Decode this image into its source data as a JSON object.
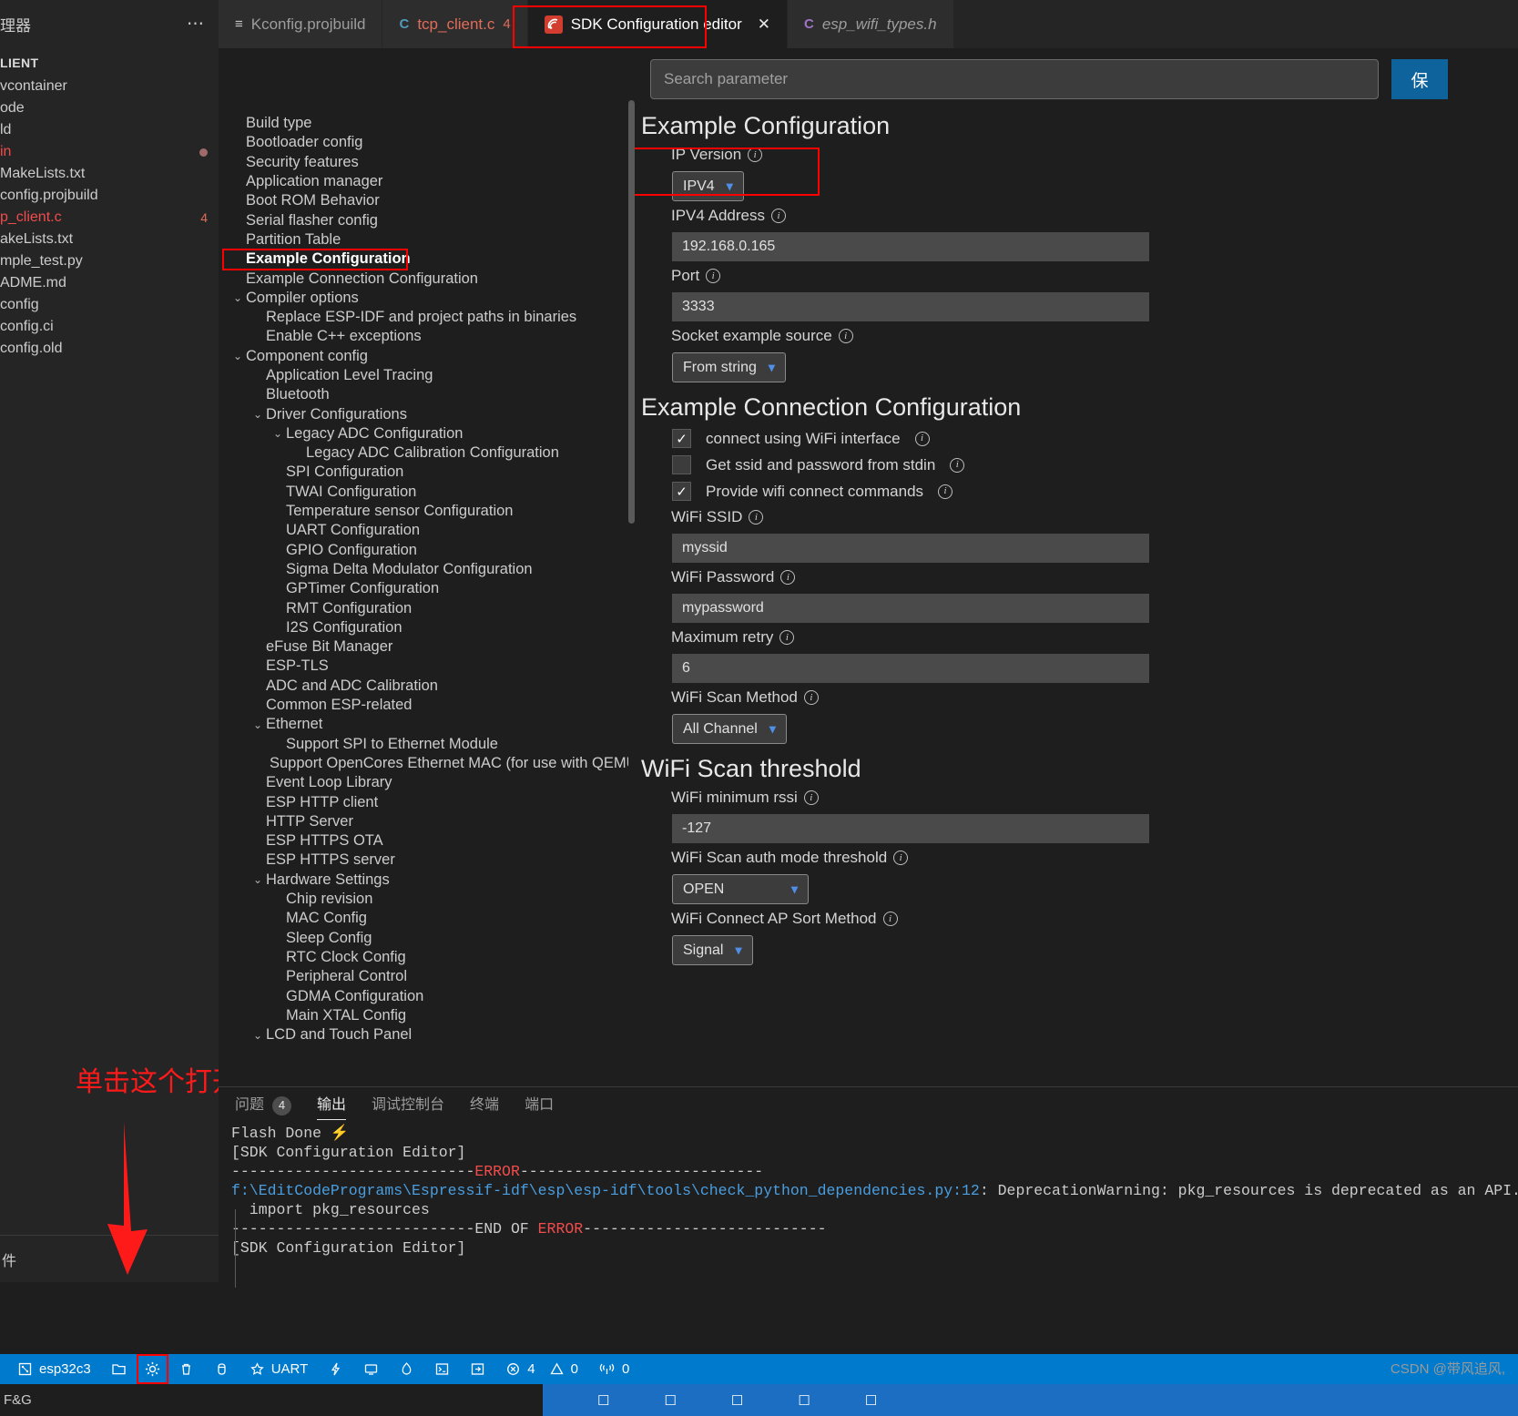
{
  "explorer": {
    "title": "理器",
    "overflow_icon": "ellipsis-icon",
    "section_label": "LIENT",
    "items": [
      {
        "label": "vcontainer",
        "state": "normal"
      },
      {
        "label": "ode",
        "state": "normal"
      },
      {
        "label": "ld",
        "state": "normal"
      },
      {
        "label": "in",
        "state": "error",
        "dot": true
      },
      {
        "label": "MakeLists.txt",
        "state": "normal"
      },
      {
        "label": "config.projbuild",
        "state": "normal"
      },
      {
        "label": "p_client.c",
        "state": "error",
        "count": "4"
      },
      {
        "label": "akeLists.txt",
        "state": "normal"
      },
      {
        "label": "mple_test.py",
        "state": "normal"
      },
      {
        "label": "ADME.md",
        "state": "normal"
      },
      {
        "label": "config",
        "state": "normal"
      },
      {
        "label": "config.ci",
        "state": "normal"
      },
      {
        "label": "config.old",
        "state": "normal"
      }
    ],
    "footer_label": "件"
  },
  "tabs": [
    {
      "label": "Kconfig.projbuild",
      "icon": "kconfig-file-icon",
      "active": false,
      "badge": "",
      "italic": false
    },
    {
      "label": "tcp_client.c",
      "icon": "c-file-icon",
      "active": false,
      "badge": "4",
      "italic": false
    },
    {
      "label": "SDK Configuration editor",
      "icon": "esp-idf-icon",
      "active": true,
      "badge": "",
      "italic": false,
      "closable": true
    },
    {
      "label": "esp_wifi_types.h",
      "icon": "c-header-file-icon",
      "active": false,
      "badge": "",
      "italic": true
    }
  ],
  "tab_close_label": "✕",
  "annotation": {
    "text": "单击这个打开menuconfig",
    "color": "#ff1a1a"
  },
  "search": {
    "placeholder": "Search parameter",
    "value": ""
  },
  "save_button_label": "保",
  "config_tree": [
    {
      "label": "Build type",
      "indent": 0,
      "chevron": ""
    },
    {
      "label": "Bootloader config",
      "indent": 0,
      "chevron": ""
    },
    {
      "label": "Security features",
      "indent": 0,
      "chevron": ""
    },
    {
      "label": "Application manager",
      "indent": 0,
      "chevron": ""
    },
    {
      "label": "Boot ROM Behavior",
      "indent": 0,
      "chevron": ""
    },
    {
      "label": "Serial flasher config",
      "indent": 0,
      "chevron": ""
    },
    {
      "label": "Partition Table",
      "indent": 0,
      "chevron": ""
    },
    {
      "label": "Example Configuration",
      "indent": 0,
      "chevron": "",
      "selected": true
    },
    {
      "label": "Example Connection Configuration",
      "indent": 0,
      "chevron": ""
    },
    {
      "label": "Compiler options",
      "indent": 0,
      "chevron": "⌄"
    },
    {
      "label": "Replace ESP-IDF and project paths in binaries",
      "indent": 1,
      "chevron": ""
    },
    {
      "label": "Enable C++ exceptions",
      "indent": 1,
      "chevron": ""
    },
    {
      "label": "Component config",
      "indent": 0,
      "chevron": "⌄"
    },
    {
      "label": "Application Level Tracing",
      "indent": 1,
      "chevron": ""
    },
    {
      "label": "Bluetooth",
      "indent": 1,
      "chevron": ""
    },
    {
      "label": "Driver Configurations",
      "indent": 1,
      "chevron": "⌄"
    },
    {
      "label": "Legacy ADC Configuration",
      "indent": 2,
      "chevron": "⌄"
    },
    {
      "label": "Legacy ADC Calibration Configuration",
      "indent": 3,
      "chevron": ""
    },
    {
      "label": "SPI Configuration",
      "indent": 2,
      "chevron": ""
    },
    {
      "label": "TWAI Configuration",
      "indent": 2,
      "chevron": ""
    },
    {
      "label": "Temperature sensor Configuration",
      "indent": 2,
      "chevron": ""
    },
    {
      "label": "UART Configuration",
      "indent": 2,
      "chevron": ""
    },
    {
      "label": "GPIO Configuration",
      "indent": 2,
      "chevron": ""
    },
    {
      "label": "Sigma Delta Modulator Configuration",
      "indent": 2,
      "chevron": ""
    },
    {
      "label": "GPTimer Configuration",
      "indent": 2,
      "chevron": ""
    },
    {
      "label": "RMT Configuration",
      "indent": 2,
      "chevron": ""
    },
    {
      "label": "I2S Configuration",
      "indent": 2,
      "chevron": ""
    },
    {
      "label": "eFuse Bit Manager",
      "indent": 1,
      "chevron": ""
    },
    {
      "label": "ESP-TLS",
      "indent": 1,
      "chevron": ""
    },
    {
      "label": "ADC and ADC Calibration",
      "indent": 1,
      "chevron": ""
    },
    {
      "label": "Common ESP-related",
      "indent": 1,
      "chevron": ""
    },
    {
      "label": "Ethernet",
      "indent": 1,
      "chevron": "⌄"
    },
    {
      "label": "Support SPI to Ethernet Module",
      "indent": 2,
      "chevron": ""
    },
    {
      "label": "Support OpenCores Ethernet MAC (for use with QEMU)",
      "indent": 2,
      "chevron": ""
    },
    {
      "label": "Event Loop Library",
      "indent": 1,
      "chevron": ""
    },
    {
      "label": "ESP HTTP client",
      "indent": 1,
      "chevron": ""
    },
    {
      "label": "HTTP Server",
      "indent": 1,
      "chevron": ""
    },
    {
      "label": "ESP HTTPS OTA",
      "indent": 1,
      "chevron": ""
    },
    {
      "label": "ESP HTTPS server",
      "indent": 1,
      "chevron": ""
    },
    {
      "label": "Hardware Settings",
      "indent": 1,
      "chevron": "⌄"
    },
    {
      "label": "Chip revision",
      "indent": 2,
      "chevron": ""
    },
    {
      "label": "MAC Config",
      "indent": 2,
      "chevron": ""
    },
    {
      "label": "Sleep Config",
      "indent": 2,
      "chevron": ""
    },
    {
      "label": "RTC Clock Config",
      "indent": 2,
      "chevron": ""
    },
    {
      "label": "Peripheral Control",
      "indent": 2,
      "chevron": ""
    },
    {
      "label": "GDMA Configuration",
      "indent": 2,
      "chevron": ""
    },
    {
      "label": "Main XTAL Config",
      "indent": 2,
      "chevron": ""
    },
    {
      "label": "LCD and Touch Panel",
      "indent": 1,
      "chevron": "⌄"
    }
  ],
  "form": {
    "section1_title": "Example Configuration",
    "ip_version": {
      "label": "IP Version",
      "value": "IPV4"
    },
    "ipv4_address": {
      "label": "IPV4 Address",
      "value": "192.168.0.165"
    },
    "port": {
      "label": "Port",
      "value": "3333"
    },
    "socket_example_source": {
      "label": "Socket example source",
      "value": "From string"
    },
    "section2_title": "Example Connection Configuration",
    "checkboxes": [
      {
        "label": "connect using WiFi interface",
        "checked": true
      },
      {
        "label": "Get ssid and password from stdin",
        "checked": false
      },
      {
        "label": "Provide wifi connect commands",
        "checked": true
      }
    ],
    "wifi_ssid": {
      "label": "WiFi SSID",
      "value": "myssid"
    },
    "wifi_password": {
      "label": "WiFi Password",
      "value": "mypassword"
    },
    "maximum_retry": {
      "label": "Maximum retry",
      "value": "6"
    },
    "wifi_scan_method": {
      "label": "WiFi Scan Method",
      "value": "All Channel"
    },
    "section3_title": "WiFi Scan threshold",
    "wifi_minimum_rssi": {
      "label": "WiFi minimum rssi",
      "value": "-127"
    },
    "wifi_scan_auth_mode_threshold": {
      "label": "WiFi Scan auth mode threshold",
      "value": "OPEN"
    },
    "wifi_connect_ap_sort_method": {
      "label": "WiFi Connect AP Sort Method",
      "value": "Signal"
    }
  },
  "panel": {
    "tabs": [
      {
        "label": "问题",
        "badge": "4",
        "active": false
      },
      {
        "label": "输出",
        "badge": "",
        "active": true
      },
      {
        "label": "调试控制台",
        "badge": "",
        "active": false
      },
      {
        "label": "终端",
        "badge": "",
        "active": false
      },
      {
        "label": "端口",
        "badge": "",
        "active": false
      }
    ],
    "output_lines": [
      {
        "text": "Flash Done ",
        "type": "plain",
        "suffix_bolt": true
      },
      {
        "text": "[SDK Configuration Editor]",
        "type": "plain"
      },
      {
        "text": "---------------------------ERROR---------------------------",
        "type": "error-divider"
      },
      {
        "text": "",
        "type": "plain"
      },
      {
        "text": "f:\\EditCodePrograms\\Espressif-idf\\esp\\esp-idf\\tools\\check_python_dependencies.py:12: DeprecationWarning: pkg_resources is deprecated as an API. See https://",
        "type": "link-line"
      },
      {
        "text": "  import pkg_resources",
        "type": "plain"
      },
      {
        "text": "",
        "type": "plain"
      },
      {
        "text": "---------------------------END OF ERROR---------------------------",
        "type": "error-end-divider"
      },
      {
        "text": "[SDK Configuration Editor]",
        "type": "plain"
      }
    ]
  },
  "statusbar": {
    "items": [
      {
        "icon": "chip-icon",
        "label": "esp32c3"
      },
      {
        "icon": "folder-icon",
        "label": ""
      },
      {
        "icon": "gear-icon",
        "label": "",
        "highlighted": true
      },
      {
        "icon": "trash-icon",
        "label": ""
      },
      {
        "icon": "database-icon",
        "label": ""
      },
      {
        "icon": "star-icon",
        "label": "UART"
      },
      {
        "icon": "bolt-icon",
        "label": ""
      },
      {
        "icon": "monitor-icon",
        "label": ""
      },
      {
        "icon": "flame-icon",
        "label": ""
      },
      {
        "icon": "terminal-icon",
        "label": ""
      },
      {
        "icon": "arrow-right-box-icon",
        "label": ""
      },
      {
        "icon": "error-circle-icon",
        "label": "4"
      },
      {
        "icon": "warning-triangle-icon",
        "label": "0"
      },
      {
        "icon": "radio-tower-icon",
        "label": "0"
      }
    ]
  },
  "taskbar": {
    "left_label": "F&G"
  },
  "watermark": "CSDN @带风追风,"
}
